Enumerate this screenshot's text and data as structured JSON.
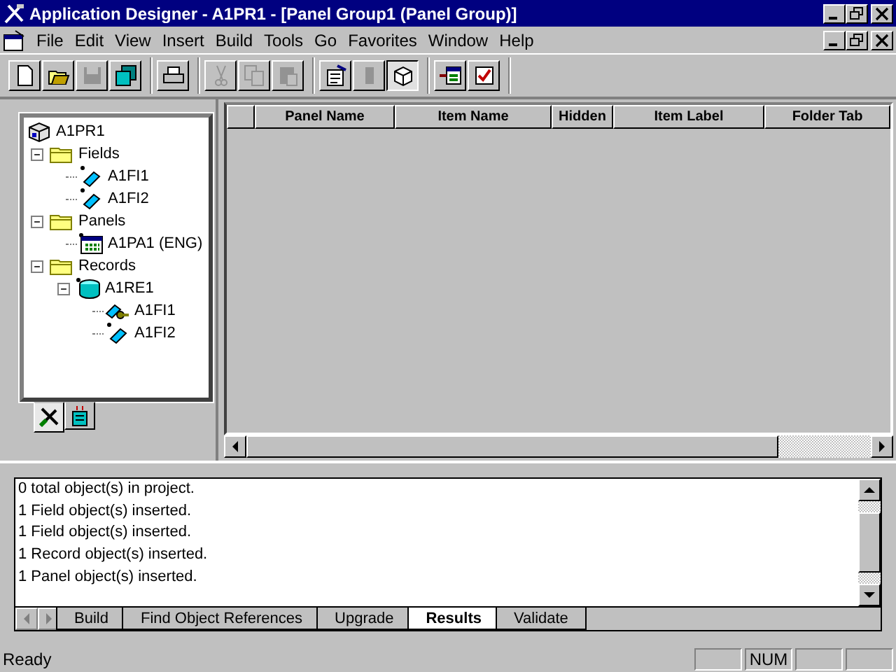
{
  "window": {
    "title": "Application Designer - A1PR1 - [Panel Group1 (Panel Group)]"
  },
  "menu": [
    "File",
    "Edit",
    "View",
    "Insert",
    "Build",
    "Tools",
    "Go",
    "Favorites",
    "Window",
    "Help"
  ],
  "toolbar": [
    [
      {
        "kind": "new",
        "disabled": false,
        "selected": false
      },
      {
        "kind": "open",
        "disabled": false,
        "selected": false
      },
      {
        "kind": "save",
        "disabled": true,
        "selected": false
      },
      {
        "kind": "save-all",
        "disabled": false,
        "selected": false
      }
    ],
    [
      {
        "kind": "print",
        "disabled": false,
        "selected": false
      }
    ],
    [
      {
        "kind": "cut",
        "disabled": true,
        "selected": false
      },
      {
        "kind": "copy",
        "disabled": true,
        "selected": false
      },
      {
        "kind": "paste",
        "disabled": true,
        "selected": false
      }
    ],
    [
      {
        "kind": "properties",
        "disabled": false,
        "selected": false
      },
      {
        "kind": "object",
        "disabled": true,
        "selected": false
      },
      {
        "kind": "project",
        "disabled": false,
        "selected": true
      }
    ],
    [
      {
        "kind": "insert",
        "disabled": false,
        "selected": false
      },
      {
        "kind": "validate",
        "disabled": false,
        "selected": false
      }
    ]
  ],
  "tree": [
    {
      "label": "A1PR1",
      "kind": "project",
      "children": [
        {
          "label": "Fields",
          "kind": "folder",
          "expanded": true,
          "children": [
            {
              "label": "A1FI1",
              "kind": "field"
            },
            {
              "label": "A1FI2",
              "kind": "field"
            }
          ]
        },
        {
          "label": "Panels",
          "kind": "folder",
          "expanded": true,
          "children": [
            {
              "label": "A1PA1 (ENG)",
              "kind": "panel"
            }
          ]
        },
        {
          "label": "Records",
          "kind": "folder",
          "expanded": true,
          "children": [
            {
              "label": "A1RE1",
              "kind": "record",
              "expanded": true,
              "children": [
                {
                  "label": "A1FI1",
                  "kind": "key-field"
                },
                {
                  "label": "A1FI2",
                  "kind": "field"
                }
              ]
            }
          ]
        }
      ]
    }
  ],
  "tree_tabs": [
    {
      "kind": "development",
      "selected": true
    },
    {
      "kind": "upgrade",
      "selected": false
    }
  ],
  "grid": {
    "columns": [
      "Panel Name",
      "Item Name",
      "Hidden",
      "Item Label",
      "Folder Tab"
    ]
  },
  "output": {
    "lines": [
      "0  total object(s) in project.",
      "1 Field object(s) inserted.",
      "1 Field object(s) inserted.",
      "1 Record object(s) inserted.",
      "1 Panel object(s) inserted."
    ],
    "tabs": [
      {
        "label": "Build",
        "selected": false
      },
      {
        "label": "Find Object References",
        "selected": false
      },
      {
        "label": "Upgrade",
        "selected": false
      },
      {
        "label": "Results",
        "selected": true
      },
      {
        "label": "Validate",
        "selected": false
      }
    ]
  },
  "status_bar": {
    "text": "Ready",
    "indicators": [
      "NUM"
    ]
  }
}
